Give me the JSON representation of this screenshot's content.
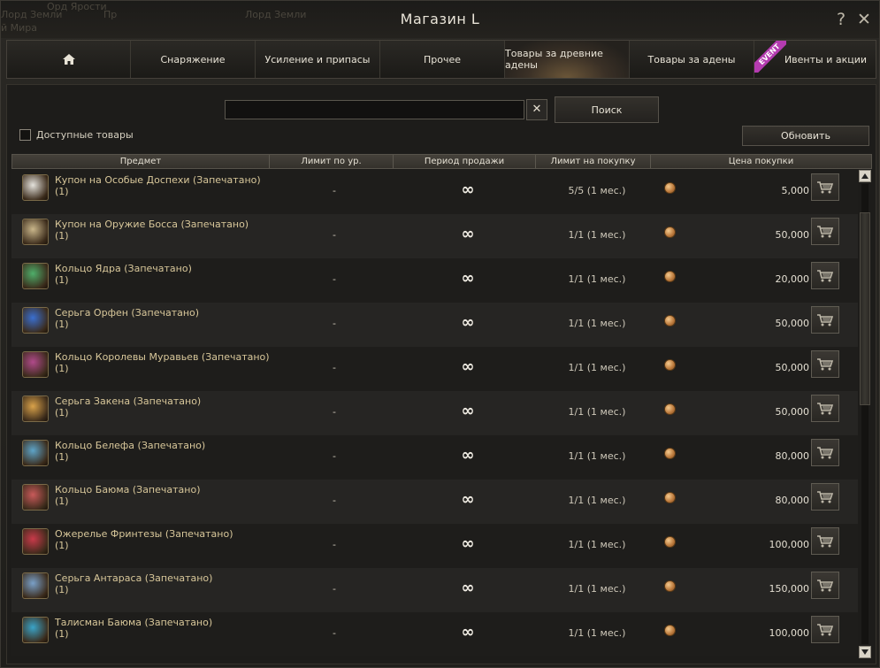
{
  "window": {
    "title": "Магазин L",
    "help_label": "?",
    "close_label": "✕",
    "background_ghost": [
      "Орд Ярости",
      "Лорд Земли",
      "Пр",
      "Лорд Земли",
      "й Мира"
    ]
  },
  "tabs": [
    {
      "label": "",
      "icon": "home-icon"
    },
    {
      "label": "Снаряжение"
    },
    {
      "label": "Усиление и припасы"
    },
    {
      "label": "Прочее"
    },
    {
      "label": "Товары за древние адены",
      "active": true
    },
    {
      "label": "Товары за адены"
    },
    {
      "label": "Ивенты и акции",
      "badge": "EVENT"
    }
  ],
  "search": {
    "value": "",
    "placeholder": "",
    "clear_label": "✕",
    "button_label": "Поиск"
  },
  "filter": {
    "available_label": "Доступные товары",
    "checked": false
  },
  "refresh_label": "Обновить",
  "table": {
    "headers": [
      "Предмет",
      "Лимит по ур.",
      "Период продажи",
      "Лимит на покупку",
      "Цена покупки"
    ],
    "rows": [
      {
        "name": "Купон на Особые Доспехи (Запечатано)",
        "qty": "(1)",
        "level": "-",
        "period": "∞",
        "limit": "5/5 (1 мес.)",
        "price": "5,000",
        "icon": "armor-coupon-icon",
        "color": "#e4e2dc"
      },
      {
        "name": "Купон на Оружие Босса (Запечатано)",
        "qty": "(1)",
        "level": "-",
        "period": "∞",
        "limit": "1/1 (1 мес.)",
        "price": "50,000",
        "icon": "weapon-coupon-icon",
        "color": "#c9b68a"
      },
      {
        "name": "Кольцо Ядра (Запечатано)",
        "qty": "(1)",
        "level": "-",
        "period": "∞",
        "limit": "1/1 (1 мес.)",
        "price": "20,000",
        "icon": "core-ring-icon",
        "color": "#4fae6a"
      },
      {
        "name": "Серьга Орфен (Запечатано)",
        "qty": "(1)",
        "level": "-",
        "period": "∞",
        "limit": "1/1 (1 мес.)",
        "price": "50,000",
        "icon": "orfen-earring-icon",
        "color": "#3a6fd0"
      },
      {
        "name": "Кольцо Королевы Муравьев (Запечатано)",
        "qty": "(1)",
        "level": "-",
        "period": "∞",
        "limit": "1/1 (1 мес.)",
        "price": "50,000",
        "icon": "queen-ant-ring-icon",
        "color": "#b04a8a"
      },
      {
        "name": "Серьга Закена (Запечатано)",
        "qty": "(1)",
        "level": "-",
        "period": "∞",
        "limit": "1/1 (1 мес.)",
        "price": "50,000",
        "icon": "zaken-earring-icon",
        "color": "#d9a24a"
      },
      {
        "name": "Кольцо Белефа (Запечатано)",
        "qty": "(1)",
        "level": "-",
        "period": "∞",
        "limit": "1/1 (1 мес.)",
        "price": "80,000",
        "icon": "beleth-ring-icon",
        "color": "#5ea4c8"
      },
      {
        "name": "Кольцо Баюма (Запечатано)",
        "qty": "(1)",
        "level": "-",
        "period": "∞",
        "limit": "1/1 (1 мес.)",
        "price": "80,000",
        "icon": "baium-ring-icon",
        "color": "#c85a5a"
      },
      {
        "name": "Ожерелье Фринтезы (Запечатано)",
        "qty": "(1)",
        "level": "-",
        "period": "∞",
        "limit": "1/1 (1 мес.)",
        "price": "100,000",
        "icon": "frintezza-necklace-icon",
        "color": "#c83a4a"
      },
      {
        "name": "Серьга Антараса (Запечатано)",
        "qty": "(1)",
        "level": "-",
        "period": "∞",
        "limit": "1/1 (1 мес.)",
        "price": "150,000",
        "icon": "antharas-earring-icon",
        "color": "#7aa0c8"
      },
      {
        "name": "Талисман Баюма (Запечатано)",
        "qty": "(1)",
        "level": "-",
        "period": "∞",
        "limit": "1/1 (1 мес.)",
        "price": "100,000",
        "icon": "baium-talisman-icon",
        "color": "#3aa4c8"
      }
    ]
  },
  "colors": {
    "item_name": "#d8c79a",
    "event_badge": "#b43bb0",
    "coin": "#d08a4a"
  }
}
